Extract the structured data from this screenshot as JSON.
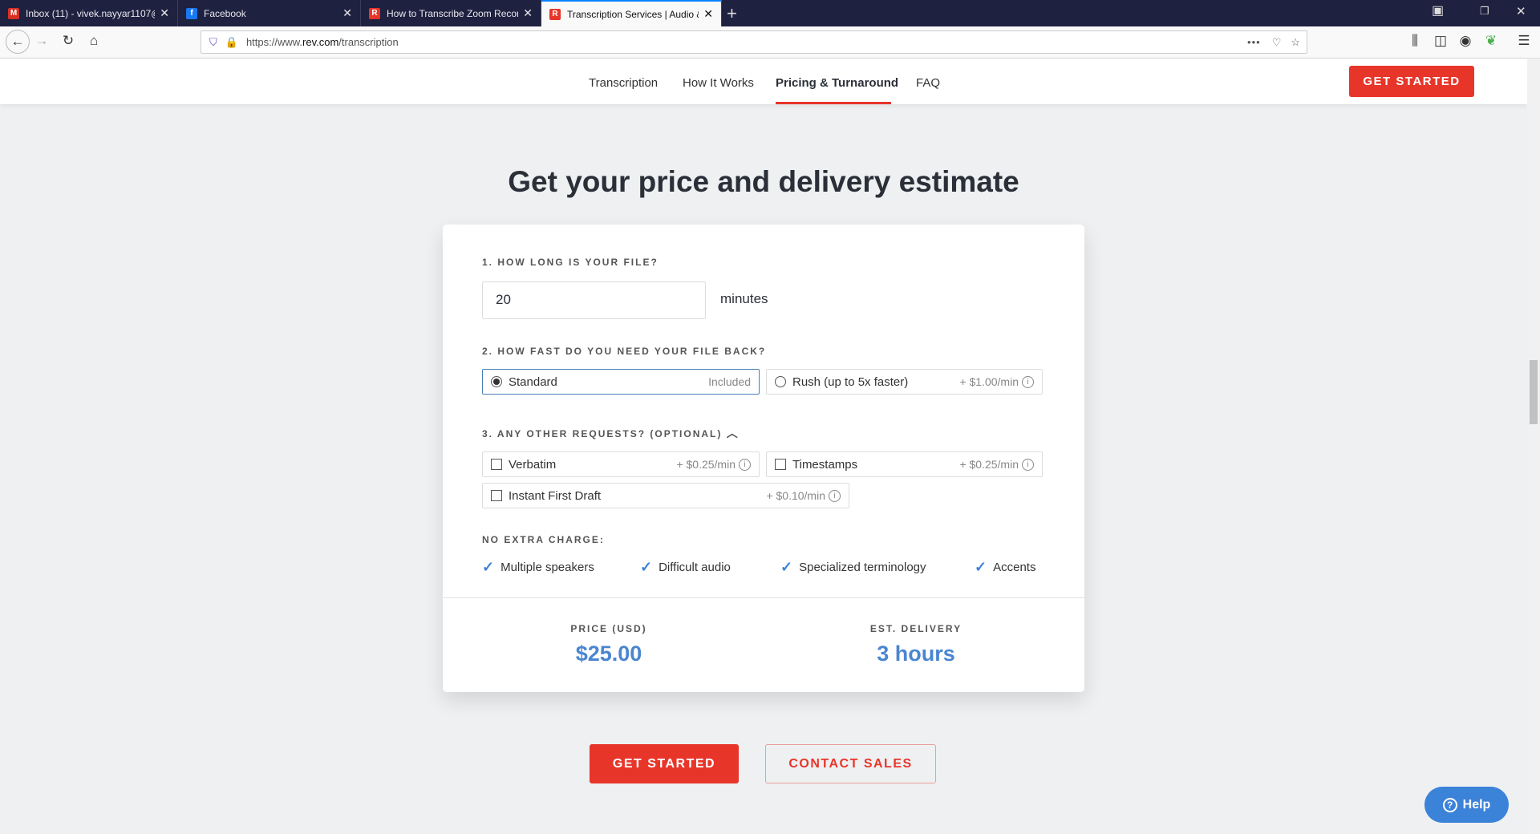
{
  "browser": {
    "tabs": [
      {
        "title": "Inbox (11) - vivek.nayyar1107@",
        "icon": "gmail-icon",
        "color": "#d93025"
      },
      {
        "title": "Facebook",
        "icon": "facebook-icon",
        "color": "#1877f2"
      },
      {
        "title": "How to Transcribe Zoom Recor",
        "icon": "rev-icon",
        "color": "#e8352a"
      },
      {
        "title": "Transcription Services | Audio &",
        "icon": "rev-icon",
        "color": "#e8352a",
        "active": true
      }
    ],
    "url_prefix": "https://www.",
    "url_domain": "rev.com",
    "url_path": "/transcription"
  },
  "nav": {
    "items": [
      "Transcription",
      "How It Works",
      "Pricing & Turnaround",
      "FAQ"
    ],
    "active": "Pricing & Turnaround",
    "cta": "GET STARTED"
  },
  "heading": "Get your price and delivery estimate",
  "form": {
    "q1": "1. HOW LONG IS YOUR FILE?",
    "duration_value": "20",
    "duration_unit": "minutes",
    "q2": "2. HOW FAST DO YOU NEED YOUR FILE BACK?",
    "speed": [
      {
        "name": "Standard",
        "price": "Included",
        "selected": true
      },
      {
        "name": "Rush (up to 5x faster)",
        "price": "+ $1.00/min",
        "selected": false
      }
    ],
    "q3": "3. ANY OTHER REQUESTS? (OPTIONAL)",
    "extras": [
      {
        "name": "Verbatim",
        "price": "+ $0.25/min",
        "checked": false
      },
      {
        "name": "Timestamps",
        "price": "+ $0.25/min",
        "checked": false
      },
      {
        "name": "Instant First Draft",
        "price": "+ $0.10/min",
        "checked": false
      }
    ],
    "no_extra_label": "NO EXTRA CHARGE:",
    "no_extra": [
      "Multiple speakers",
      "Difficult audio",
      "Specialized terminology",
      "Accents"
    ]
  },
  "summary": {
    "price_label": "PRICE (USD)",
    "price": "$25.00",
    "delivery_label": "EST. DELIVERY",
    "delivery": "3 hours"
  },
  "actions": {
    "get_started": "GET STARTED",
    "contact_sales": "CONTACT SALES"
  },
  "help": "Help",
  "colors": {
    "accent": "#e8352a",
    "value_blue": "#4a86d0",
    "tabbar": "#1f2140"
  }
}
